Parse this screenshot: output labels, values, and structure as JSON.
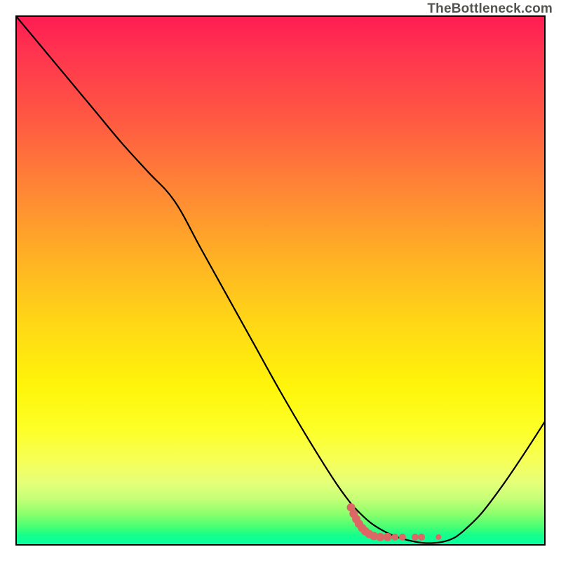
{
  "watermark": "TheBottleneck.com",
  "colors": {
    "curve_stroke": "#000000",
    "marker_fill": "#dc6765",
    "marker_stroke": "#dc6765"
  },
  "chart_data": {
    "type": "line",
    "title": "",
    "xlabel": "",
    "ylabel": "",
    "xlim": [
      0,
      100
    ],
    "ylim": [
      0,
      100
    ],
    "grid": false,
    "legend": false,
    "series": [
      {
        "name": "bottleneck-curve",
        "x": [
          0,
          5,
          10,
          15,
          20,
          25,
          30,
          35,
          40,
          45,
          50,
          55,
          60,
          63,
          65,
          67,
          69,
          71,
          73,
          75,
          77,
          79,
          81,
          83,
          85,
          88,
          92,
          96,
          100
        ],
        "y": [
          100,
          94,
          88,
          82,
          76,
          70.5,
          65,
          56,
          47,
          38,
          29,
          20.5,
          12.5,
          8.3,
          6.1,
          4.3,
          3.0,
          2.0,
          1.3,
          0.8,
          0.5,
          0.5,
          0.8,
          1.6,
          3.2,
          6.2,
          11.5,
          17.4,
          23.6
        ]
      }
    ],
    "markers": {
      "name": "bottleneck-markers",
      "points": [
        {
          "x": 63.3,
          "y": 7.2,
          "r": 6
        },
        {
          "x": 63.8,
          "y": 6.0,
          "r": 6
        },
        {
          "x": 64.3,
          "y": 5.0,
          "r": 6
        },
        {
          "x": 64.8,
          "y": 4.1,
          "r": 6
        },
        {
          "x": 65.4,
          "y": 3.3,
          "r": 6
        },
        {
          "x": 66.0,
          "y": 2.7,
          "r": 6
        },
        {
          "x": 66.7,
          "y": 2.2,
          "r": 6
        },
        {
          "x": 67.6,
          "y": 1.8,
          "r": 6
        },
        {
          "x": 68.8,
          "y": 1.6,
          "r": 6
        },
        {
          "x": 70.2,
          "y": 1.6,
          "r": 6
        },
        {
          "x": 71.6,
          "y": 1.6,
          "r": 5
        },
        {
          "x": 73.0,
          "y": 1.6,
          "r": 5
        },
        {
          "x": 75.4,
          "y": 1.6,
          "r": 5
        },
        {
          "x": 76.6,
          "y": 1.6,
          "r": 5
        },
        {
          "x": 79.8,
          "y": 1.6,
          "r": 4
        }
      ]
    }
  }
}
